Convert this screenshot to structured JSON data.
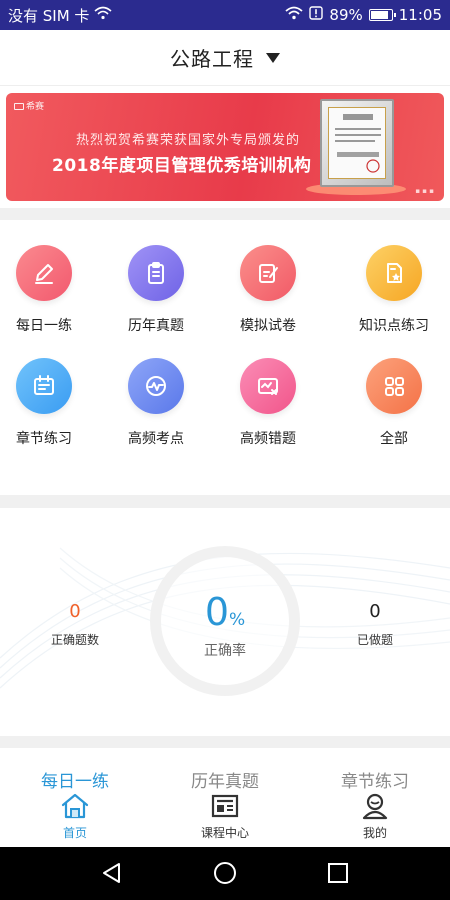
{
  "status_bar": {
    "carrier": "没有 SIM 卡",
    "battery": "89%",
    "battery_level": 0.89,
    "time": "11:05"
  },
  "header": {
    "title": "公路工程"
  },
  "banner": {
    "logo": "希赛",
    "subtitle": "热烈祝贺希赛荣获国家外专局颁发的",
    "headline": "2018年度项目管理优秀培训机构"
  },
  "grid": [
    {
      "label": "每日一练",
      "icon": "pencil-icon",
      "color": "#f96b7a"
    },
    {
      "label": "历年真题",
      "icon": "clipboard-icon",
      "color": "#8b7bf0"
    },
    {
      "label": "模拟试卷",
      "icon": "edit-paper-icon",
      "color": "#f56c78"
    },
    {
      "label": "知识点练习",
      "icon": "doc-star-icon",
      "color": "#f9bd3d"
    },
    {
      "label": "章节练习",
      "icon": "calendar-check-icon",
      "color": "#4bb0f7"
    },
    {
      "label": "高频考点",
      "icon": "heartbeat-icon",
      "color": "#6f8ef3"
    },
    {
      "label": "高频错题",
      "icon": "chart-x-icon",
      "color": "#f86d9b"
    },
    {
      "label": "全部",
      "icon": "grid-icon",
      "color": "#f98a5a"
    }
  ],
  "stats": {
    "correct_count": "0",
    "correct_count_label": "正确题数",
    "rate_value": "0",
    "rate_unit": "%",
    "rate_label": "正确率",
    "done_count": "0",
    "done_count_label": "已做题"
  },
  "subtabs": [
    {
      "label": "每日一练",
      "active": true
    },
    {
      "label": "历年真题",
      "active": false
    },
    {
      "label": "章节练习",
      "active": false
    }
  ],
  "bottom_nav": [
    {
      "label": "首页",
      "icon": "home-icon",
      "active": true
    },
    {
      "label": "课程中心",
      "icon": "course-icon",
      "active": false
    },
    {
      "label": "我的",
      "icon": "profile-icon",
      "active": false
    }
  ],
  "colors": {
    "accent": "#2a96d6",
    "status_bar": "#2b2b8f",
    "banner": "#e83b4a",
    "correct_count": "#f0612a"
  }
}
